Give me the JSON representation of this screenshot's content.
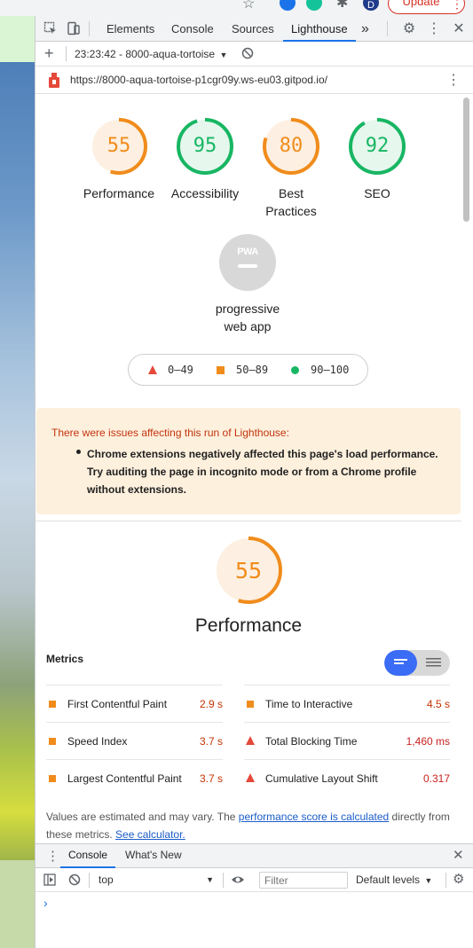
{
  "browser": {
    "update_label": "Update",
    "profile_initial": "D"
  },
  "devtools": {
    "tabs": [
      "Elements",
      "Console",
      "Sources",
      "Lighthouse"
    ],
    "active_tab": "Lighthouse",
    "more_tabs_label": "»"
  },
  "lighthouse_toolbar": {
    "add_label": "+",
    "report_select": "23:23:42 - 8000-aqua-tortoise"
  },
  "url_bar": {
    "url": "https://8000-aqua-tortoise-p1cgr09y.ws-eu03.gitpod.io/"
  },
  "scores": [
    {
      "label": "Performance",
      "score": "55",
      "color": "#f08c1c",
      "bg": "#fdf0e2",
      "fraction": 0.55
    },
    {
      "label": "Accessibility",
      "score": "95",
      "color": "#18b663",
      "bg": "#e6f7ee",
      "fraction": 0.95
    },
    {
      "label": "Best",
      "label2": "Practices",
      "score": "80",
      "color": "#f08c1c",
      "bg": "#fdf0e2",
      "fraction": 0.8
    },
    {
      "label": "SEO",
      "score": "92",
      "color": "#18b663",
      "bg": "#e6f7ee",
      "fraction": 0.92
    }
  ],
  "pwa": {
    "badge_text": "PWA",
    "label_line1": "progressive",
    "label_line2": "web app"
  },
  "legend": {
    "fail": "0–49",
    "average": "50–89",
    "pass": "90–100"
  },
  "warning": {
    "title": "There were issues affecting this run of Lighthouse:",
    "bullet": "Chrome extensions negatively affected this page's load performance. Try auditing the page in incognito mode or from a Chrome profile without extensions."
  },
  "performance": {
    "score": "55",
    "fraction": 0.55,
    "title": "Performance",
    "metrics_label": "Metrics",
    "metrics": [
      {
        "name": "First Contentful Paint",
        "value": "2.9 s",
        "status": "average"
      },
      {
        "name": "Time to Interactive",
        "value": "4.5 s",
        "status": "average"
      },
      {
        "name": "Speed Index",
        "value": "3.7 s",
        "status": "average"
      },
      {
        "name": "Total Blocking Time",
        "value": "1,460 ms",
        "status": "fail"
      },
      {
        "name": "Largest Contentful Paint",
        "value": "3.7 s",
        "status": "average"
      },
      {
        "name": "Cumulative Layout Shift",
        "value": "0.317",
        "status": "fail"
      }
    ],
    "note_prefix": "Values are estimated and may vary. The ",
    "note_link1": "performance score is calculated",
    "note_mid": " directly from these metrics. ",
    "note_link2": "See calculator."
  },
  "drawer": {
    "tabs": [
      "Console",
      "What's New"
    ],
    "active_tab": "Console",
    "context": "top",
    "filter_placeholder": "Filter",
    "levels": "Default levels",
    "prompt": "›"
  },
  "colors": {
    "fail": "#e5493a",
    "average": "#f08c1c",
    "pass": "#18b663",
    "link": "#1a5cc8",
    "warning_text": "#c2350f",
    "accent": "#1a73e8"
  }
}
